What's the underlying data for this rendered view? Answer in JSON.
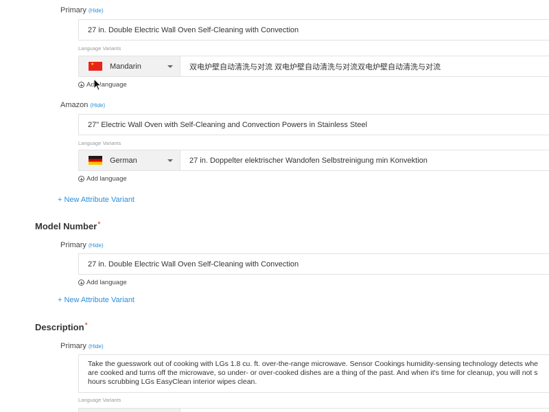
{
  "sections": {
    "product_name": {
      "primary": {
        "label": "Primary",
        "hide": "(Hide)",
        "value": "27 in. Double Electric Wall Oven Self-Cleaning with Convection",
        "lang_variants_label": "Language Variants",
        "language": {
          "name": "Mandarin",
          "flag": "china-flag-icon",
          "value": "双电炉壁自动清洗与对流 双电炉壁自动清洗与对流双电炉壁自动清洗与对流"
        },
        "add_language": "Add language"
      },
      "amazon": {
        "label": "Amazon",
        "hide": "(Hide)",
        "value": "27\" Electric Wall Oven with Self-Cleaning and Convection Powers in Stainless Steel",
        "lang_variants_label": "Language Variants",
        "language": {
          "name": "German",
          "flag": "germany-flag-icon",
          "value": "27 in. Doppelter elektrischer Wandofen Selbstreinigung min Konvektion"
        },
        "add_language": "Add language"
      },
      "new_variant": "+ New Attribute Variant"
    },
    "model_number": {
      "title": "Model Number",
      "required": "*",
      "primary": {
        "label": "Primary",
        "hide": "(Hide)",
        "value": "27 in. Double Electric Wall Oven Self-Cleaning with Convection",
        "add_language": "Add language"
      },
      "new_variant": "+ New Attribute Variant"
    },
    "description": {
      "title": "Description",
      "required": "*",
      "primary": {
        "label": "Primary",
        "hide": "(Hide)",
        "lines": [
          "Take the guesswork out of cooking with LGs 1.8 cu. ft. over-the-range microwave. Sensor Cookings humidity-sensing technology detects whe",
          "are cooked and turns off the microwave, so under- or over-cooked dishes are a thing of the past. And when it's time for cleanup, you will not s",
          "hours scrubbing LGs EasyClean interior wipes clean."
        ],
        "lang_variants_label": "Language Variants"
      }
    }
  },
  "colors": {
    "link": "#2a8fd6",
    "required": "#e0301e",
    "field_border": "#e2e2e2",
    "select_bg": "#f1f1f1"
  }
}
